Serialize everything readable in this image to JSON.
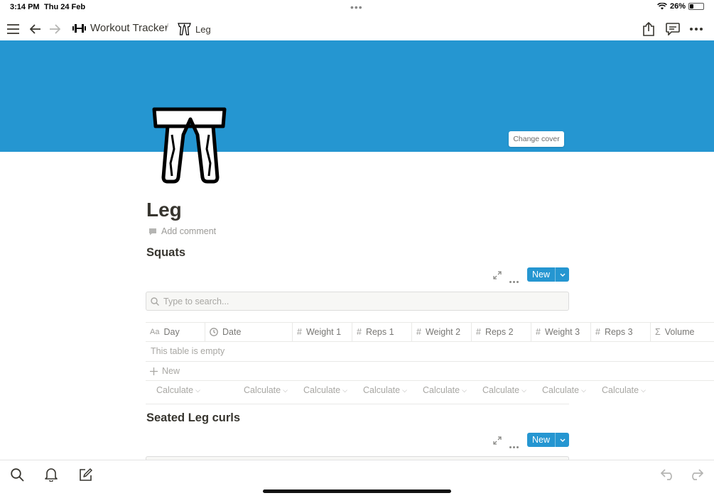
{
  "status": {
    "time": "3:14 PM",
    "date": "Thu 24 Feb",
    "battery": "26%"
  },
  "nav": {
    "menu_icon": "hamburger-icon",
    "back_icon": "arrow-left-icon",
    "forward_icon": "arrow-right-icon",
    "breadcrumb": [
      {
        "label": "Workout Tracker",
        "icon": "dumbbell-icon"
      },
      {
        "label": "Leg",
        "icon": "legs-icon"
      }
    ],
    "separator": "/",
    "share_icon": "share-icon",
    "comments_icon": "comment-icon",
    "more_icon": "more-icon"
  },
  "cover": {
    "color": "#2596d1",
    "change_cover_label": "Change cover"
  },
  "page": {
    "title": "Leg",
    "add_comment_label": "Add comment"
  },
  "databases": [
    {
      "title": "Squats",
      "new_label": "New",
      "search_placeholder": "Type to search...",
      "columns": [
        {
          "label": "Day",
          "icon": "text-aa-icon"
        },
        {
          "label": "Date",
          "icon": "clock-icon"
        },
        {
          "label": "Weight 1",
          "icon": "hash-icon"
        },
        {
          "label": "Reps 1",
          "icon": "hash-icon"
        },
        {
          "label": "Weight 2",
          "icon": "hash-icon"
        },
        {
          "label": "Reps 2",
          "icon": "hash-icon"
        },
        {
          "label": "Weight 3",
          "icon": "hash-icon"
        },
        {
          "label": "Reps 3",
          "icon": "hash-icon"
        },
        {
          "label": "Volume",
          "icon": "sigma-icon"
        }
      ],
      "empty_text": "This table is empty",
      "new_row_label": "New",
      "calculate_label": "Calculate"
    },
    {
      "title": "Seated Leg curls",
      "new_label": "New"
    }
  ],
  "accent_color": "#2596d1"
}
